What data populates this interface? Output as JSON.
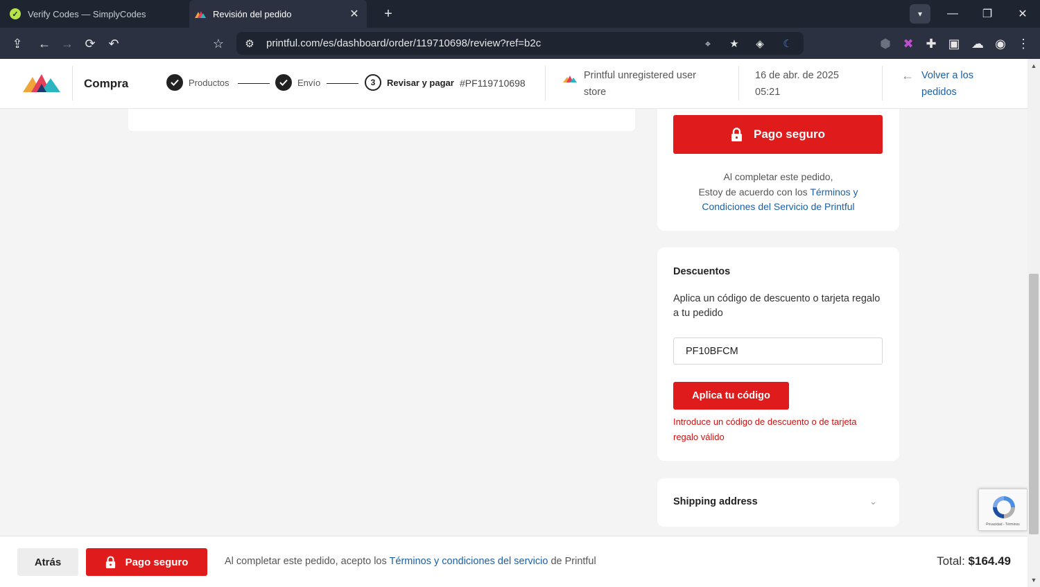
{
  "browser": {
    "tabs": [
      {
        "title": "Verify Codes — SimplyCodes",
        "active": false
      },
      {
        "title": "Revisión del pedido",
        "active": true
      }
    ],
    "url": "printful.com/es/dashboard/order/119710698/review?ref=b2c"
  },
  "header": {
    "section_title": "Compra",
    "steps": [
      {
        "label": "Productos",
        "state": "done"
      },
      {
        "label": "Envío",
        "state": "done"
      },
      {
        "number": "3",
        "label": "Revisar y pagar",
        "state": "current"
      }
    ],
    "order_number": "#PF119710698",
    "store_name": "Printful unregistered user store",
    "date": "16 de abr. de 2025 05:21",
    "back_link": "Volver a los pedidos"
  },
  "payment": {
    "secure_pay_label": "Pago seguro",
    "agree_line1": "Al completar este pedido,",
    "agree_line2": "Estoy de acuerdo con los",
    "terms_link": "Términos y Condiciones del Servicio de Printful"
  },
  "discounts": {
    "title": "Descuentos",
    "description": "Aplica un código de descuento o tarjeta regalo a tu pedido",
    "code_value": "PF10BFCM",
    "apply_label": "Aplica tu código",
    "error": "Introduce un código de descuento o de tarjeta regalo válido"
  },
  "shipping": {
    "title": "Shipping address"
  },
  "recaptcha": {
    "label": "Privacidad - Términos"
  },
  "footer": {
    "back_label": "Atrás",
    "pay_label": "Pago seguro",
    "text_before": "Al completar este pedido, acepto los",
    "terms_link": "Términos y condiciones del servicio",
    "text_after": "de Printful",
    "total_label": "Total:",
    "total_value": "$164.49"
  },
  "colors": {
    "accent_red": "#e01b1b",
    "link_blue": "#1a5fa6",
    "error_red": "#cc1111",
    "browser_dark": "#1e2430"
  }
}
